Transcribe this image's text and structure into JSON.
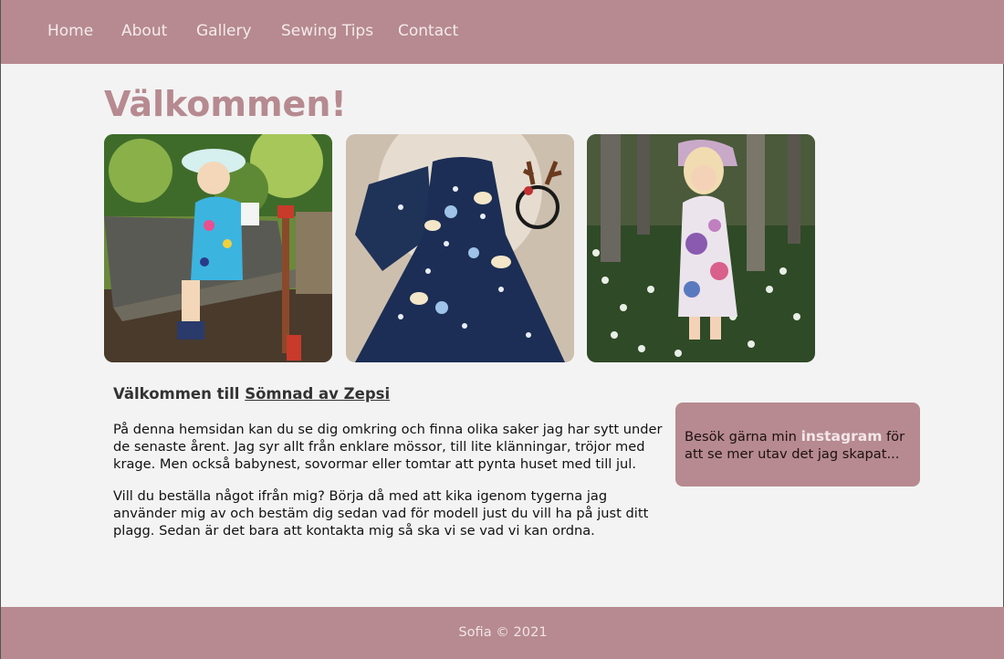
{
  "nav": {
    "items": [
      {
        "label": "Home"
      },
      {
        "label": "About"
      },
      {
        "label": "Gallery"
      },
      {
        "label": "Sewing Tips"
      },
      {
        "label": "Contact"
      }
    ]
  },
  "main": {
    "title": "Välkommen!",
    "heading_prefix": "Välkommen till ",
    "heading_link": "Sömnad av Zepsi",
    "paragraphs": [
      "På denna hemsidan kan du se dig omkring och finna olika saker jag har sytt under de senaste årent. Jag syr allt från enklare mössor, till lite klänningar, tröjor med krage. Men också babynest, sovormar eller tomtar att pynta huset med till jul.",
      "Vill du beställa något ifrån mig? Börja då med att kika igenom tygerna jag använder mig av och bestäm dig sedan vad för modell just du vill ha på just ditt plagg. Sedan är det bara att kontakta mig så ska vi se vad vi kan ordna."
    ]
  },
  "aside": {
    "before": "Besök gärna min ",
    "link": "instagram",
    "after": " för att se mer utav det jag skapat..."
  },
  "footer": {
    "text": "Sofia © 2021"
  },
  "colors": {
    "brand": "#b68a90",
    "background": "#f3f3f3"
  }
}
